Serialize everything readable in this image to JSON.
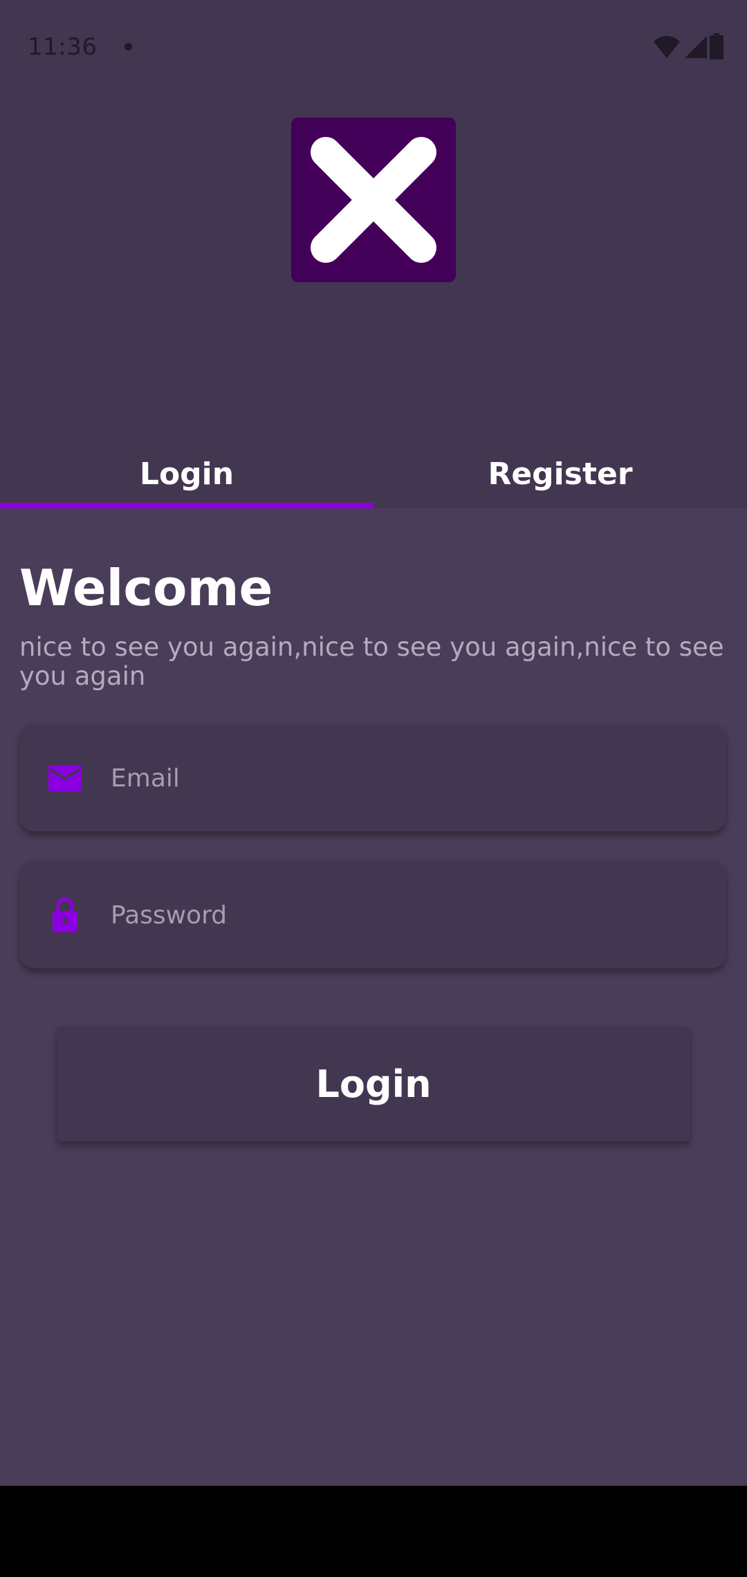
{
  "status_bar": {
    "time": "11:36"
  },
  "logo": {
    "icon": "close-x-logo",
    "color": "#430058"
  },
  "tabs": [
    {
      "label": "Login",
      "active": true
    },
    {
      "label": "Register",
      "active": false
    }
  ],
  "welcome": {
    "title": "Welcome",
    "subtitle": "nice to see you again,nice to see you again,nice to see you again"
  },
  "form": {
    "email": {
      "placeholder": "Email",
      "value": "",
      "icon": "mail-icon"
    },
    "password": {
      "placeholder": "Password",
      "value": "",
      "icon": "lock-icon"
    },
    "submit_label": "Login"
  },
  "colors": {
    "background": "#4a3d59",
    "header": "#433651",
    "accent": "#8a00e0"
  }
}
